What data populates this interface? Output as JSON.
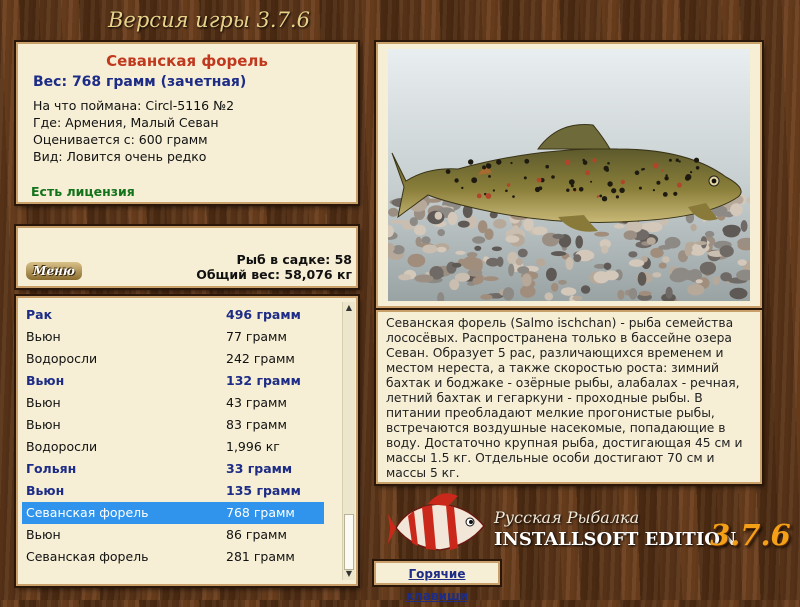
{
  "header": {
    "version_label": "Версия игры 3.7.6"
  },
  "fish_info": {
    "name": "Севанская форель",
    "weight": "Вес: 768 грамм (зачетная)",
    "caught_with": "На что поймана: Circl-5116 №2",
    "location": "Где: Армения, Малый Севан",
    "valued_from": "Оценивается с: 600 грамм",
    "kind": "Вид: Ловится очень редко",
    "license": "Есть лицензия"
  },
  "stats": {
    "menu_label": "Меню",
    "fish_in_keepnet": "Рыб в садке: 58",
    "total_weight": "Общий вес: 58,076 кг"
  },
  "catch_list": [
    {
      "name": "Рак",
      "weight": "496 грамм",
      "style": "bold"
    },
    {
      "name": "Вьюн",
      "weight": "77 грамм",
      "style": "normal"
    },
    {
      "name": "Водоросли",
      "weight": "242 грамм",
      "style": "normal"
    },
    {
      "name": "Вьюн",
      "weight": "132 грамм",
      "style": "bold"
    },
    {
      "name": "Вьюн",
      "weight": "43 грамм",
      "style": "normal"
    },
    {
      "name": "Вьюн",
      "weight": "83 грамм",
      "style": "normal"
    },
    {
      "name": "Водоросли",
      "weight": "1,996 кг",
      "style": "normal"
    },
    {
      "name": "Гольян",
      "weight": "33 грамм",
      "style": "bold"
    },
    {
      "name": "Вьюн",
      "weight": "135 грамм",
      "style": "bold"
    },
    {
      "name": "Севанская форель",
      "weight": "768 грамм",
      "style": "selected"
    },
    {
      "name": "Вьюн",
      "weight": "86 грамм",
      "style": "normal"
    },
    {
      "name": "Севанская форель",
      "weight": "281 грамм",
      "style": "normal"
    }
  ],
  "description": "Севанская форель (Salmo ischchan) - рыба семейства лососёвых. Распространена только в бассейне озера Севан. Образует 5 рас, различающихся временем и местом нереста, а также скоростью роста: зимний бахтак и бодж­аке - озёрные рыбы, алабалах - речная, летний бахтак и гегаркуни - проходные рыбы. В питании преобладают мелкие прогонистые рыбы, встречаются воздушные насекомые, попадающие в воду. Достаточно крупная рыба, достигающая 45 см и массы 1.5 кг. Отдельные особи достигают 70 см и массы 5 кг.",
  "brand": {
    "line1": "Русская Рыбалка",
    "line2": "INSTALLSOFT EDITION",
    "version": "3.7.6"
  },
  "hotkeys_label": "Горячие клавиши",
  "icons": {
    "scroll_up": "scroll-up-arrow-icon",
    "scroll_down": "scroll-down-arrow-icon",
    "logo": "striped-fish-logo-icon"
  },
  "colors": {
    "panel_bg": "#f6efd6",
    "fish_name": "#c0391f",
    "weight_blue": "#1d2c86",
    "license_green": "#12731a",
    "selection": "#3194ec",
    "version_orange": "#f3a018"
  }
}
